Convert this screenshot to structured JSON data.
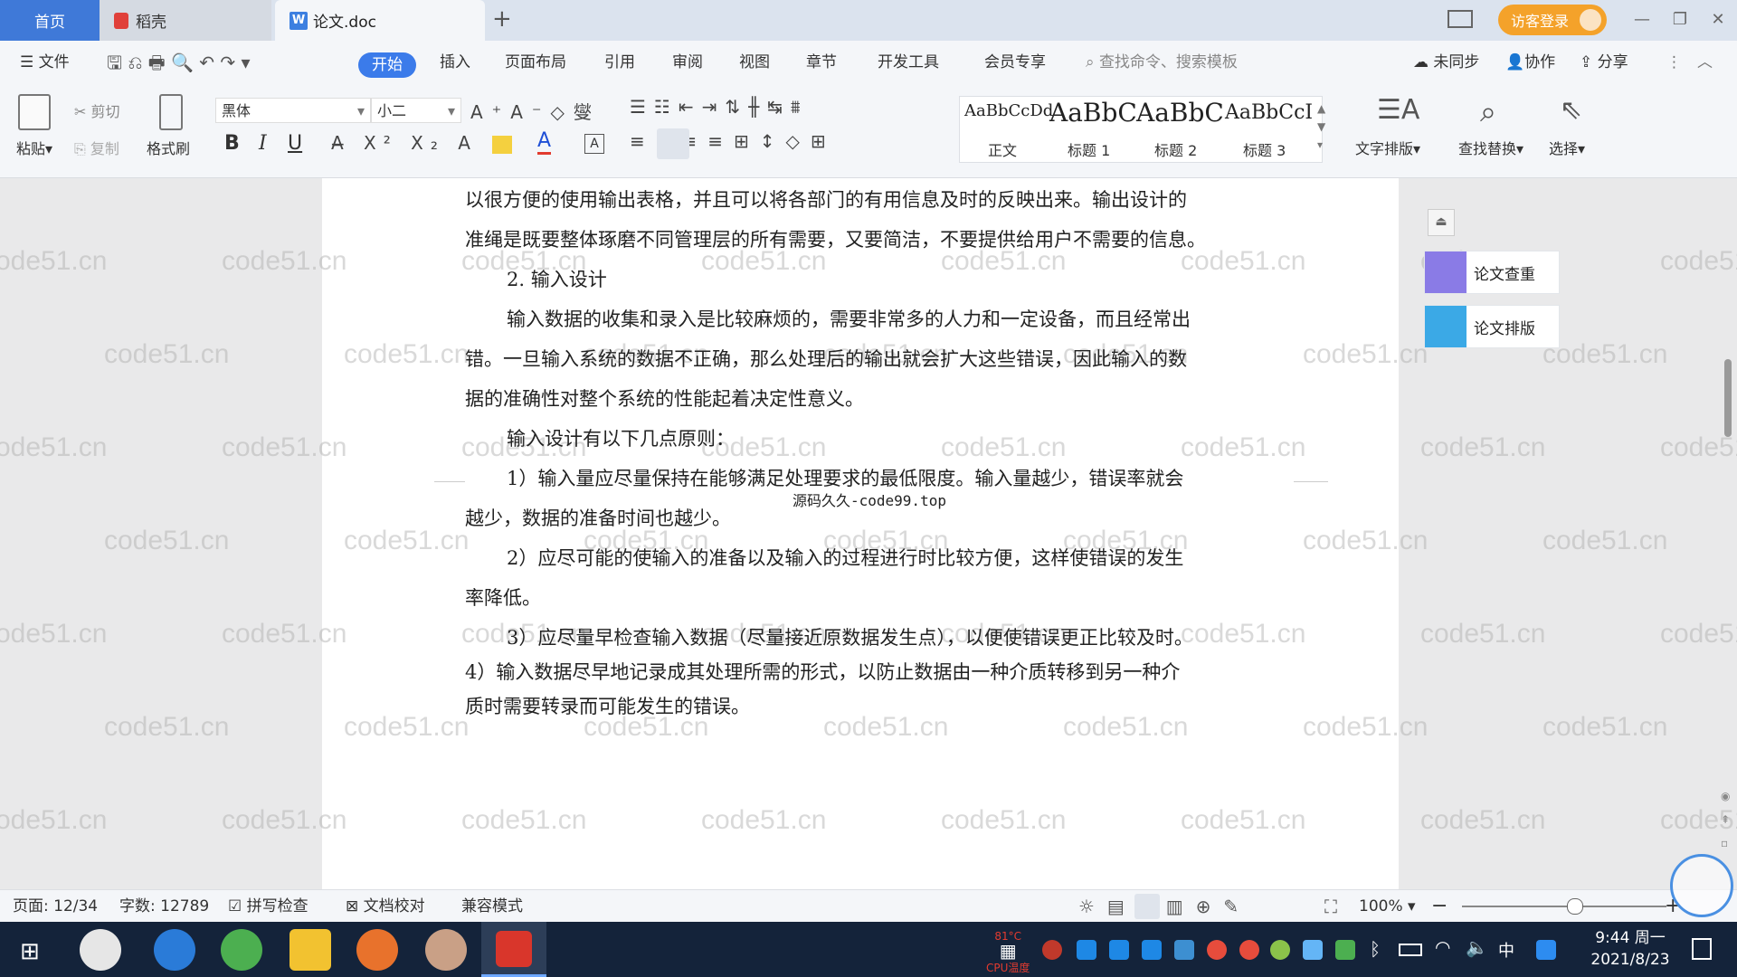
{
  "titlebar": {
    "tabs": [
      {
        "label": "首页"
      },
      {
        "label": "稻壳"
      },
      {
        "label": "论文.doc"
      }
    ],
    "new_tab": "+",
    "guest_login": "访客登录"
  },
  "menubar": {
    "file": "文件",
    "items": [
      "开始",
      "插入",
      "页面布局",
      "引用",
      "审阅",
      "视图",
      "章节",
      "开发工具",
      "会员专享"
    ],
    "search_placeholder": "查找命令、搜索模板",
    "right": {
      "sync": "未同步",
      "collab": "协作",
      "share": "分享"
    }
  },
  "ribbon": {
    "paste": "粘贴",
    "cut": "剪切",
    "copy": "复制",
    "format_painter": "格式刷",
    "font_name": "黑体",
    "font_size": "小二",
    "bold": "B",
    "italic": "I",
    "underline": "U",
    "styles": [
      {
        "sample": "AaBbCcDd",
        "label": "正文"
      },
      {
        "sample": "AaBbC",
        "label": "标题 1"
      },
      {
        "sample": "AaBbC",
        "label": "标题 2"
      },
      {
        "sample": "AaBbCcI",
        "label": "标题 3"
      }
    ],
    "text_layout": "文字排版",
    "find_replace": "查找替换",
    "select": "选择"
  },
  "document": {
    "paragraphs": [
      "以很方便的使用输出表格，并且可以将各部门的有用信息及时的反映出来。输出设计的",
      "准绳是既要整体琢磨不同管理层的所有需要，又要简洁，不要提供给用户不需要的信息。",
      "2. 输入设计",
      "输入数据的收集和录入是比较麻烦的，需要非常多的人力和一定设备，而且经常出",
      "错。一旦输入系统的数据不正确，那么处理后的输出就会扩大这些错误，因此输入的数",
      "据的准确性对整个系统的性能起着决定性意义。",
      "输入设计有以下几点原则：",
      "1）输入量应尽量保持在能够满足处理要求的最低限度。输入量越少，错误率就会",
      "越少，数据的准备时间也越少。",
      "2）应尽可能的使输入的准备以及输入的过程进行时比较方便，这样使错误的发生",
      "率降低。",
      "3）应尽量早检查输入数据（尽量接近原数据发生点），以便使错误更正比较及时。",
      "4）输入数据尽早地记录成其处理所需的形式，以防止数据由一种介质转移到另一种介",
      "质时需要转录而可能发生的错误。"
    ],
    "overlay_text": "源码久久-code99.top",
    "watermark": "code51.cn"
  },
  "side_panel": {
    "check": "论文查重",
    "layout": "论文排版"
  },
  "statusbar": {
    "page": "页面: 12/34",
    "words": "字数: 12789",
    "spell": "拼写检查",
    "proof": "文档校对",
    "compat": "兼容模式",
    "zoom": "100%",
    "zoom_level": 0.55
  },
  "taskbar": {
    "time": "9:44 周一",
    "date": "2021/8/23",
    "ime": "中",
    "cpu": "CPU温度",
    "cpu_val": "81°C"
  }
}
